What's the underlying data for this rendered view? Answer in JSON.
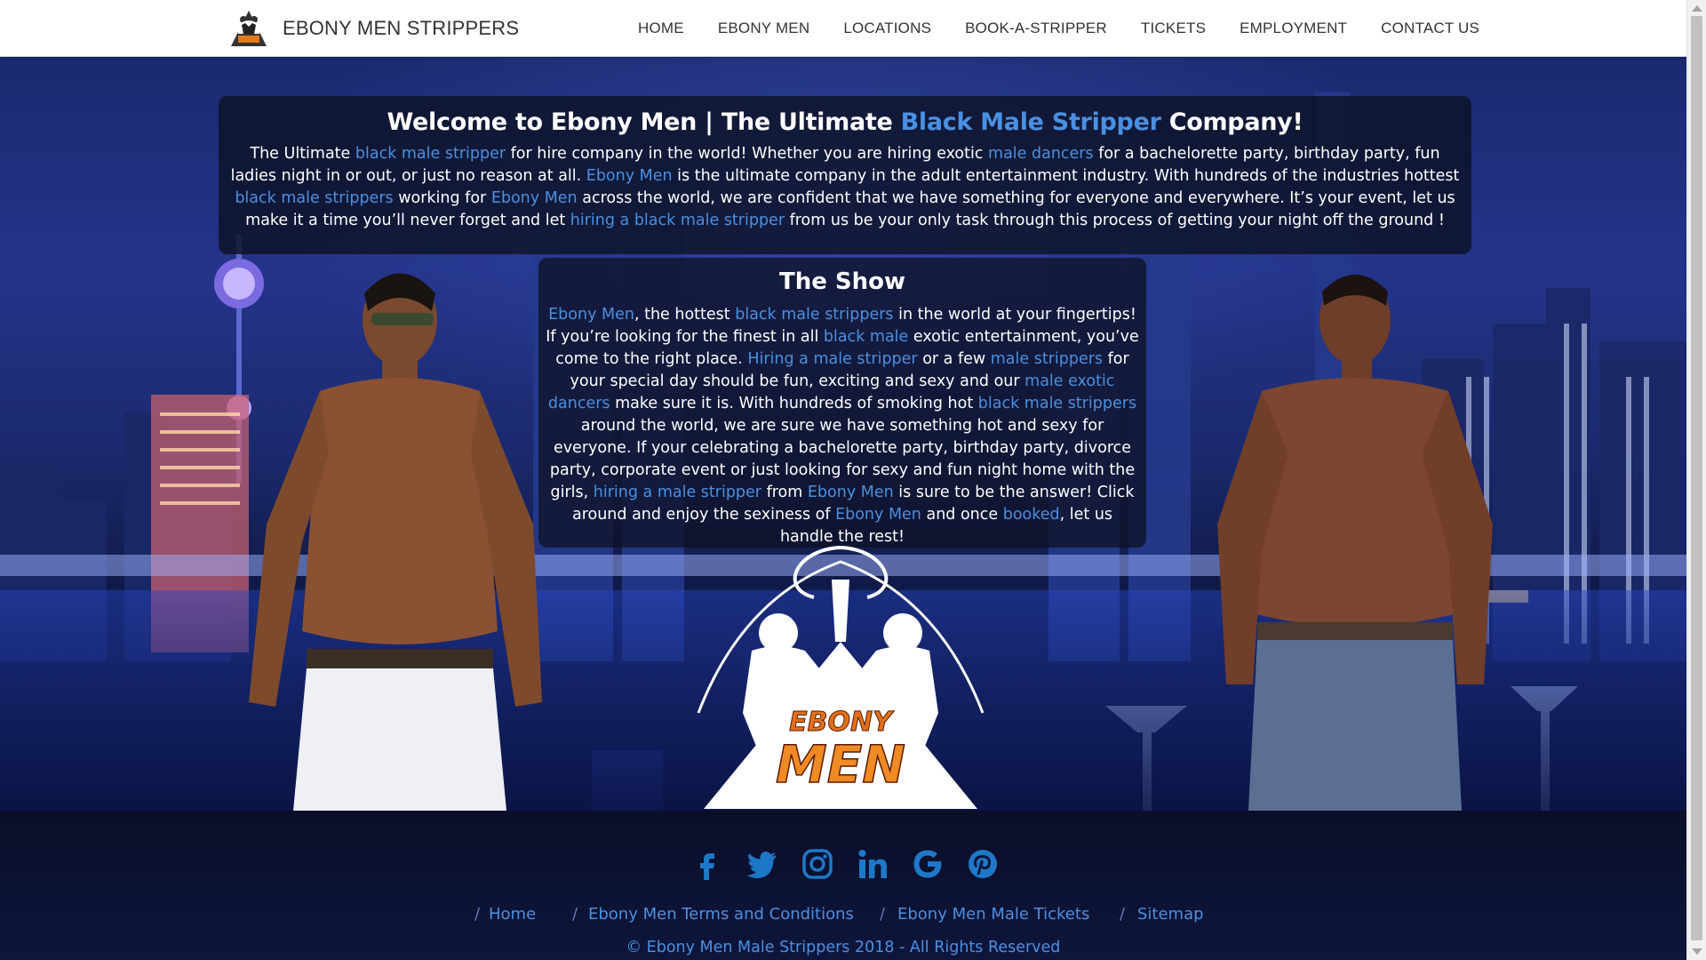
{
  "brand": {
    "name": "EBONY MEN STRIPPERS",
    "logo_icon": "silhouette-logo-icon"
  },
  "nav": {
    "items": [
      "HOME",
      "EBONY MEN",
      "LOCATIONS",
      "BOOK-A-STRIPPER",
      "TICKETS",
      "EMPLOYMENT",
      "CONTACT US"
    ]
  },
  "welcome": {
    "title_pre": "Welcome to Ebony Men | The Ultimate ",
    "title_link": "Black Male Stripper",
    "title_post": " Company!",
    "body": [
      {
        "t": "The Ultimate "
      },
      {
        "l": "black male stripper"
      },
      {
        "t": " for hire company in the world! Whether you are hiring exotic "
      },
      {
        "l": "male dancers"
      },
      {
        "t": " for a bachelorette party, birthday party, fun ladies night in or out, or just no reason at all. "
      },
      {
        "l": "Ebony Men"
      },
      {
        "t": " is the ultimate company in the adult entertainment industry. With hundreds of the industries hottest "
      },
      {
        "l": "black male strippers"
      },
      {
        "t": " working for "
      },
      {
        "l": "Ebony Men"
      },
      {
        "t": " across the world, we are confident that we have something for everyone and everywhere. It’s your event, let us make it a time you’ll never forget and let "
      },
      {
        "l": "hiring a black male stripper"
      },
      {
        "t": " from us be your only task through this process of getting your night off the ground !"
      }
    ]
  },
  "show": {
    "title": "The Show",
    "body": [
      {
        "l": "Ebony Men"
      },
      {
        "t": ", the hottest "
      },
      {
        "l": "black male strippers"
      },
      {
        "t": " in the world at your fingertips! If you’re looking for the finest in all "
      },
      {
        "l": "black male"
      },
      {
        "t": " exotic entertainment, you’ve come to the right place. "
      },
      {
        "l": "Hiring a male stripper"
      },
      {
        "t": " or a few "
      },
      {
        "l": "male strippers"
      },
      {
        "t": " for your special day should be fun, exciting and sexy and our "
      },
      {
        "l": "male exotic dancers"
      },
      {
        "t": " make sure it is. With hundreds of smoking hot "
      },
      {
        "l": "black male strippers"
      },
      {
        "t": " around the world, we are sure we have something hot and sexy for everyone. If your celebrating a bachelorette party, birthday party, divorce party, corporate event or just looking for sexy and fun night home with the girls, "
      },
      {
        "l": "hiring a male stripper"
      },
      {
        "t": " from "
      },
      {
        "l": "Ebony Men"
      },
      {
        "t": " is sure to be the answer! Click around and enjoy the sexiness of "
      },
      {
        "l": "Ebony Men"
      },
      {
        "t": " and once "
      },
      {
        "l": "booked"
      },
      {
        "t": ", let us handle the rest!"
      }
    ]
  },
  "center_logo": {
    "line1": "EBONY",
    "line2": "MEN"
  },
  "social": {
    "icons": [
      "facebook-icon",
      "twitter-icon",
      "instagram-icon",
      "linkedin-icon",
      "google-icon",
      "pinterest-icon"
    ]
  },
  "footer": {
    "links": [
      "Home",
      "Ebony Men Terms and Conditions",
      "Ebony Men Male Tickets",
      "Sitemap"
    ],
    "separator": "/",
    "copyright": "© Ebony Men Male Strippers 2018 - All Rights Reserved"
  },
  "colors": {
    "link": "#4a90e2",
    "panel_bg": "#0e1226",
    "nav_text": "#333333"
  }
}
